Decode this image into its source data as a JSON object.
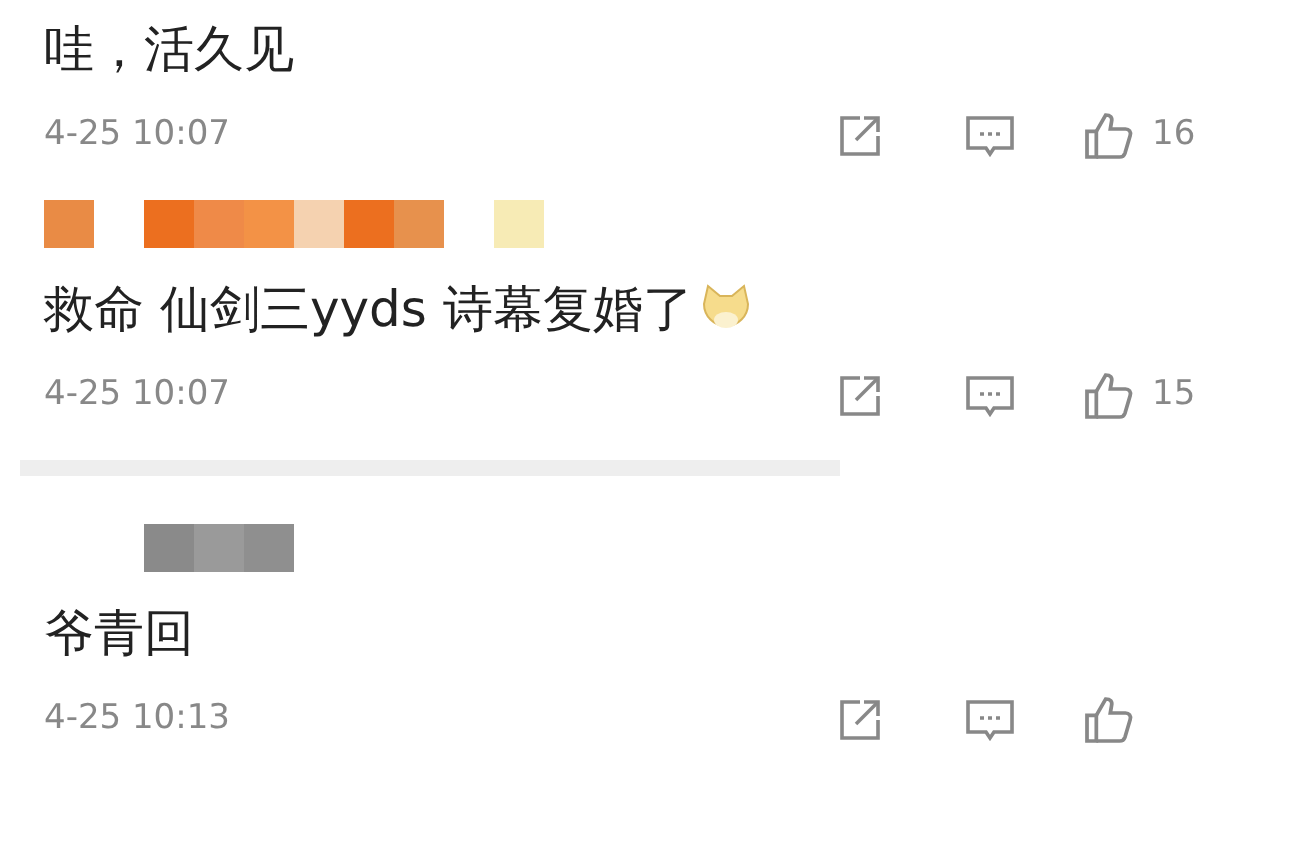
{
  "comments": [
    {
      "kind": "plain",
      "text": "哇，活久见",
      "emoji": false,
      "time": "4-25 10:07",
      "likes": "16",
      "divider": false
    },
    {
      "kind": "warm_name",
      "text": "救命 仙剑三yyds 诗幕复婚了",
      "emoji": true,
      "time": "4-25 10:07",
      "likes": "15",
      "divider": true
    },
    {
      "kind": "gray_name",
      "text": "爷青回",
      "emoji": false,
      "time": "4-25 10:13",
      "divider": false
    }
  ]
}
